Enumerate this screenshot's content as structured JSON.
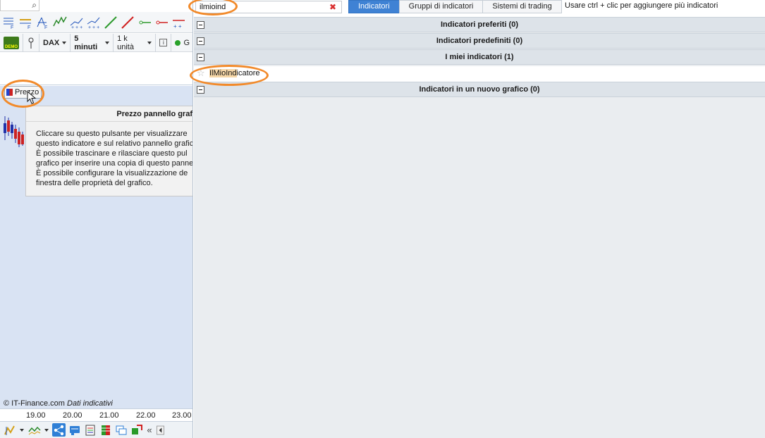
{
  "left_panel": {
    "chart_toolbar": {
      "demo_badge": "DEMO",
      "instrument": "DAX",
      "timeframe": "5 minuti",
      "units": "1 k unità",
      "info_icon": "i",
      "status_letter": "G"
    },
    "prezzo_button": "Prezzo",
    "tooltip": {
      "title": "Prezzo pannello graf",
      "lines": [
        "Cliccare su questo pulsante per visualizzare",
        "questo indicatore e sul relativo pannello grafic",
        "È possibile trascinare e rilasciare questo pul",
        "grafico per inserire una copia di questo panne",
        "È possibile configurare la visualizzazione de",
        "finestra delle proprietà del grafico."
      ]
    },
    "credit": {
      "source": "© IT-Finance.com",
      "note": "Dati indicativi"
    },
    "time_axis": [
      "19.00",
      "20.00",
      "21.00",
      "22.00",
      "23.00"
    ],
    "bottom_toolbar": {
      "collapse_label": "«"
    }
  },
  "right_panel": {
    "search": {
      "value": "ilmioind",
      "clear_icon": "✖"
    },
    "tabs": [
      "Indicatori",
      "Gruppi di indicatori",
      "Sistemi di trading"
    ],
    "active_tab": "Indicatori",
    "hint": "Usare ctrl + clic per aggiungere più indicatori",
    "sections": {
      "favorites": "Indicatori preferiti (0)",
      "predefined": "Indicatori predefiniti (0)",
      "mine": "I miei indicatori (1)",
      "new_chart": "Indicatori in un nuovo grafico (0)"
    },
    "my_indicator": {
      "match": "IlMioInd",
      "rest": "icatore",
      "star_icon": "☆"
    }
  },
  "colors": {
    "accent": "#3f82d4",
    "highlight_ring": "#f28a2a",
    "chart_bg": "#d9e3f3",
    "section_bg": "#dde3e9"
  }
}
